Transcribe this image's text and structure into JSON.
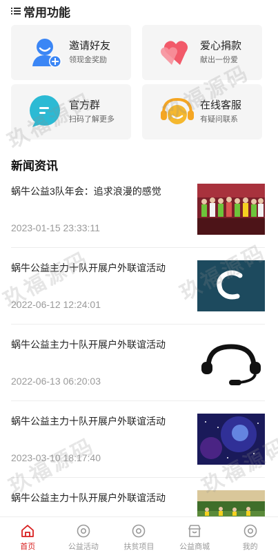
{
  "section": {
    "title": "常用功能",
    "icon": "list-icon"
  },
  "functions": [
    {
      "name": "邀请好友",
      "sub": "领现金奖励",
      "icon": "invite-user-icon"
    },
    {
      "name": "爱心捐款",
      "sub": "献出一份爱",
      "icon": "hearts-icon"
    },
    {
      "name": "官方群",
      "sub": "扫码了解更多",
      "icon": "chat-bubble-icon"
    },
    {
      "name": "在线客服",
      "sub": "有疑问联系",
      "icon": "headset-icon"
    }
  ],
  "news": {
    "title": "新闻资讯",
    "items": [
      {
        "headline": "蜗牛公益3队年会：追求浪漫的感觉",
        "date": "2023-01-15 23:33:11",
        "thumb": "group-photo"
      },
      {
        "headline": "蜗牛公益主力十队开展户外联谊活动",
        "date": "2022-06-12 12:24:01",
        "thumb": "logo-c"
      },
      {
        "headline": "蜗牛公益主力十队开展户外联谊活动",
        "date": "2022-06-13 06:20:03",
        "thumb": "headset"
      },
      {
        "headline": "蜗牛公益主力十队开展户外联谊活动",
        "date": "2023-03-10 18:17:40",
        "thumb": "galaxy"
      },
      {
        "headline": "蜗牛公益主力十队开展户外联谊活动",
        "date": "",
        "thumb": "outdoor-group"
      }
    ]
  },
  "tabbar": [
    {
      "label": "首页",
      "icon": "home-icon",
      "active": true
    },
    {
      "label": "公益活动",
      "icon": "circle-icon",
      "active": false
    },
    {
      "label": "扶贫项目",
      "icon": "circle-icon",
      "active": false
    },
    {
      "label": "公益商城",
      "icon": "shop-icon",
      "active": false
    },
    {
      "label": "我的",
      "icon": "circle-icon",
      "active": false
    }
  ],
  "watermark": "玖福源码",
  "colors": {
    "active": "#d81e1e",
    "inactive": "#999999",
    "card_bg": "#f5f5f5"
  }
}
